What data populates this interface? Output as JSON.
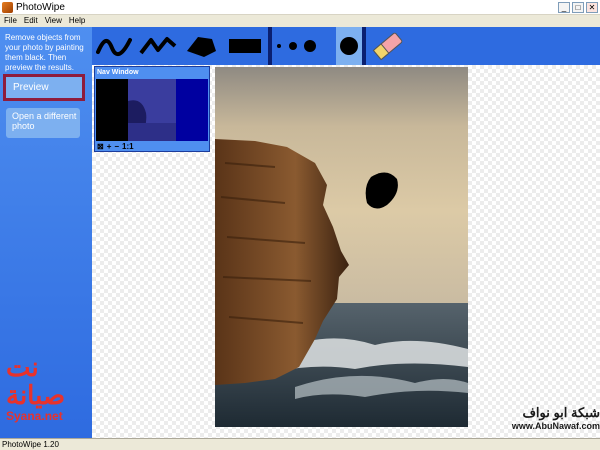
{
  "window": {
    "title": "PhotoWipe",
    "controls": [
      "_",
      "□",
      "✕"
    ]
  },
  "menu": [
    "File",
    "Edit",
    "View",
    "Help"
  ],
  "sidebar": {
    "intro": "Remove objects from your photo by painting them black. Then preview the results.",
    "preview_label": "Preview",
    "open_label": "Open a different photo"
  },
  "toolbar": {
    "tools": [
      "freehand-brush-icon",
      "zigzag-brush-icon",
      "polygon-fill-icon",
      "rectangle-fill-icon"
    ],
    "brush_sizes": [
      "small-dot-icon",
      "medium-dot-icon",
      "large-dot-icon",
      "xlarge-dot-icon"
    ],
    "eraser": "eraser-icon"
  },
  "nav_window": {
    "title": "Nav Window",
    "zoom_label": "1:1"
  },
  "watermark_left": {
    "arabic": "نت صيانة",
    "latin": "Syana.net"
  },
  "watermark_bottom": {
    "arabic": "شبكة ابو نواف",
    "url": "www.AbuNawaf.com"
  },
  "status": {
    "version": "PhotoWipe 1.20"
  },
  "colors": {
    "sidebar": "#2e6be0",
    "toolbar": "#2e6be0",
    "preview_border": "#8f1c3c",
    "watermark": "#e8322c"
  }
}
